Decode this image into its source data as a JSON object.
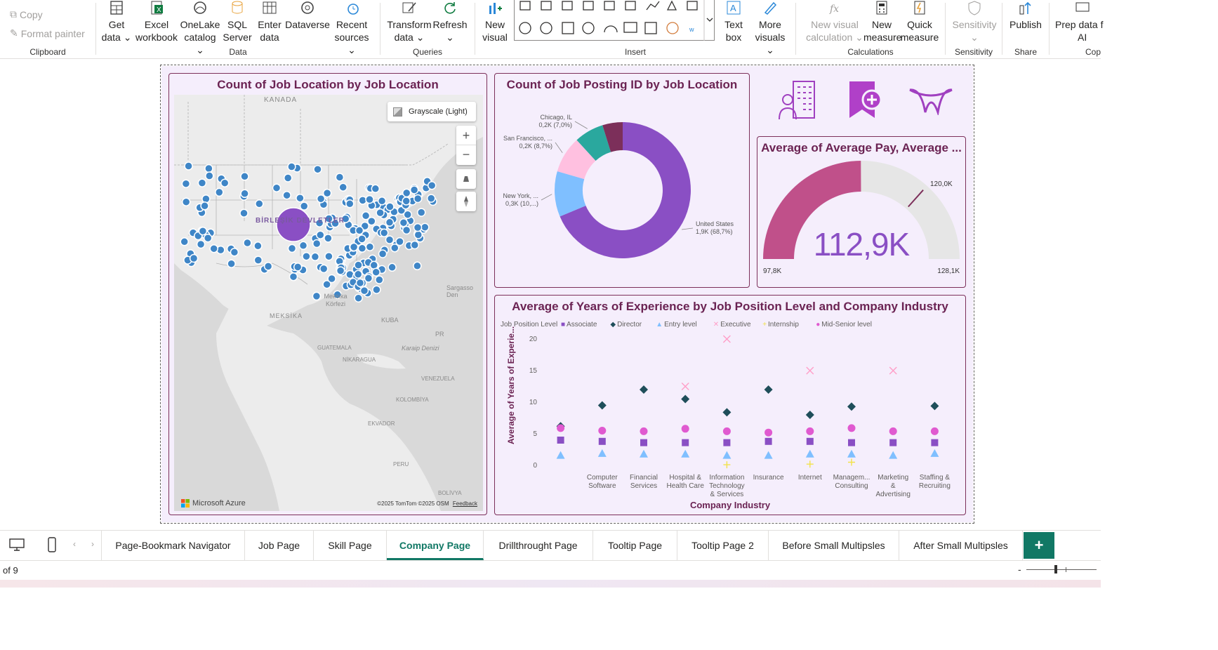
{
  "ribbon": {
    "clipboard": {
      "copy": "Copy",
      "format_painter": "Format painter",
      "label": "Clipboard"
    },
    "data": {
      "label": "Data",
      "buttons": [
        {
          "line1": "Get",
          "line2": "data ⌄"
        },
        {
          "line1": "Excel",
          "line2": "workbook"
        },
        {
          "line1": "OneLake",
          "line2": "catalog ⌄"
        },
        {
          "line1": "SQL",
          "line2": "Server"
        },
        {
          "line1": "Enter",
          "line2": "data"
        },
        {
          "line1": "Dataverse",
          "line2": ""
        },
        {
          "line1": "Recent",
          "line2": "sources ⌄"
        }
      ]
    },
    "queries": {
      "label": "Queries",
      "buttons": [
        {
          "line1": "Transform",
          "line2": "data ⌄"
        },
        {
          "line1": "Refresh",
          "line2": "⌄"
        }
      ]
    },
    "insert": {
      "label": "Insert",
      "new_visual": {
        "line1": "New",
        "line2": "visual"
      },
      "text_box": {
        "line1": "Text",
        "line2": "box"
      },
      "more_visuals": {
        "line1": "More",
        "line2": "visuals ⌄"
      }
    },
    "calculations": {
      "label": "Calculations",
      "new_visual_calc": {
        "line1": "New visual",
        "line2": "calculation ⌄"
      },
      "new_measure": {
        "line1": "New",
        "line2": "measure"
      },
      "quick_measure": {
        "line1": "Quick",
        "line2": "measure"
      }
    },
    "sensitivity": {
      "label": "Sensitivity",
      "button": "Sensitivity",
      "chev": "⌄"
    },
    "share": {
      "label": "Share",
      "button": "Publish"
    },
    "copilot": {
      "label": "Cop",
      "line1": "Prep data f",
      "line2": "AI"
    }
  },
  "map_visual": {
    "title": "Count of Job Location by Job Location",
    "style_button": "Grayscale (Light)",
    "labels": {
      "kanada": "KANADA",
      "birlesik": "BİRLEŞİK DEVLETLER",
      "meksika": "MEKSİKA",
      "meksika_korfezi": "Meksika Körfezi",
      "kuba": "KUBA",
      "sargasso": "Sargasso Den",
      "guatemala": "GUATEMALA",
      "nikaragua": "NİKARAGUA",
      "karaip": "Karaip Denizi",
      "venezuela": "VENEZUELA",
      "kolombiya": "KOLOMBİYA",
      "ekvador": "EKVADOR",
      "peru": "PERU",
      "bolivya": "BOLİVYA",
      "pr": "PR"
    },
    "attribution": "Microsoft Azure",
    "copyright": "©2025 TomTom  ©2025 OSM",
    "feedback": "Feedback"
  },
  "donut_visual": {
    "title": "Count of Job Posting ID by Job Location",
    "slices": [
      {
        "label": "United States",
        "value_label": "1,9K (68,7%)",
        "pct": 68.7,
        "color": "#8a4fc4"
      },
      {
        "label": "New York, ...",
        "value_label": "0,3K (10,...)",
        "pct": 10.8,
        "color": "#7fbfff"
      },
      {
        "label": "San Francisco, ...",
        "value_label": "0,2K (8,7%)",
        "pct": 8.7,
        "color": "#ffc0e0"
      },
      {
        "label": "Chicago, IL",
        "value_label": "0,2K (7,0%)",
        "pct": 7.0,
        "color": "#2aa89e"
      },
      {
        "label": "",
        "value_label": "",
        "pct": 4.8,
        "color": "#7c2f5a"
      }
    ]
  },
  "gauge_visual": {
    "title": "Average of Average Pay, Average ...",
    "value_label": "112,9K",
    "value": 112.9,
    "min_label": "97,8K",
    "max_label": "128,1K",
    "min": 97.8,
    "max": 128.1,
    "target_label": "120,0K",
    "target": 120.0,
    "fill_color": "#c0508a",
    "track_color": "#e6e6e6"
  },
  "scatter_visual": {
    "title": "Average of Years of Experience by Job Position Level and Company Industry",
    "legend_title": "Job Position Level",
    "xlabel": "Company Industry",
    "ylabel": "Average of Years of Experie..."
  },
  "chart_data": {
    "type": "scatter",
    "title": "Average of Years of Experience by Job Position Level and Company Industry",
    "xlabel": "Company Industry",
    "ylabel": "Average of Years of Experie...",
    "ylim": [
      0,
      20
    ],
    "yticks": [
      "0",
      "5",
      "10",
      "15",
      "20"
    ],
    "categories": [
      [
        "",
        "",
        ""
      ],
      [
        "Computer",
        "Software",
        ""
      ],
      [
        "Financial",
        "Services",
        ""
      ],
      [
        "Hospital &",
        "Health Care",
        ""
      ],
      [
        "Information",
        "Technology",
        "& Services"
      ],
      [
        "Insurance",
        "",
        ""
      ],
      [
        "Internet",
        "",
        ""
      ],
      [
        "Managem...",
        "Consulting",
        ""
      ],
      [
        "Marketing",
        "&",
        "Advertising"
      ],
      [
        "Staffing &",
        "Recruiting",
        ""
      ]
    ],
    "series": [
      {
        "name": "Associate",
        "marker": "square",
        "color": "#8a4fc4",
        "values": [
          4.0,
          3.8,
          3.6,
          3.6,
          3.6,
          3.8,
          3.8,
          3.6,
          3.6,
          3.6
        ]
      },
      {
        "name": "Director",
        "marker": "diamond",
        "color": "#1f4e5a",
        "values": [
          6.2,
          9.5,
          12.0,
          10.5,
          8.4,
          12.0,
          8.0,
          9.3,
          null,
          9.4
        ]
      },
      {
        "name": "Entry level",
        "marker": "triangle",
        "color": "#7fbfff",
        "values": [
          1.6,
          1.9,
          1.8,
          1.8,
          1.6,
          1.6,
          1.8,
          1.8,
          1.6,
          1.9
        ]
      },
      {
        "name": "Executive",
        "marker": "x",
        "color": "#ff9ec8",
        "values": [
          null,
          null,
          null,
          12.5,
          20.0,
          null,
          15.0,
          null,
          15.0,
          null
        ]
      },
      {
        "name": "Internship",
        "marker": "plus",
        "color": "#f2e24a",
        "values": [
          null,
          null,
          null,
          null,
          0.1,
          null,
          0.2,
          0.5,
          null,
          null
        ]
      },
      {
        "name": "Mid-Senior level",
        "marker": "circle",
        "color": "#e05ad0",
        "values": [
          5.9,
          5.5,
          5.4,
          5.8,
          5.4,
          5.2,
          5.4,
          5.9,
          5.4,
          5.4
        ]
      }
    ],
    "legend_position": "top-left"
  },
  "tabs": [
    {
      "label": "Page-Bookmark Navigator"
    },
    {
      "label": "Job Page"
    },
    {
      "label": "Skill Page"
    },
    {
      "label": "Company Page"
    },
    {
      "label": "Drillthrought Page"
    },
    {
      "label": "Tooltip Page"
    },
    {
      "label": "Tooltip Page 2"
    },
    {
      "label": "Before Small Multipsles"
    },
    {
      "label": "After Small Multipsles"
    }
  ],
  "active_tab": "Company Page",
  "status": {
    "page_text": "of 9"
  },
  "colors": {
    "accent": "#117865",
    "title": "#6b2353",
    "panel_bg": "#f5eefc"
  }
}
